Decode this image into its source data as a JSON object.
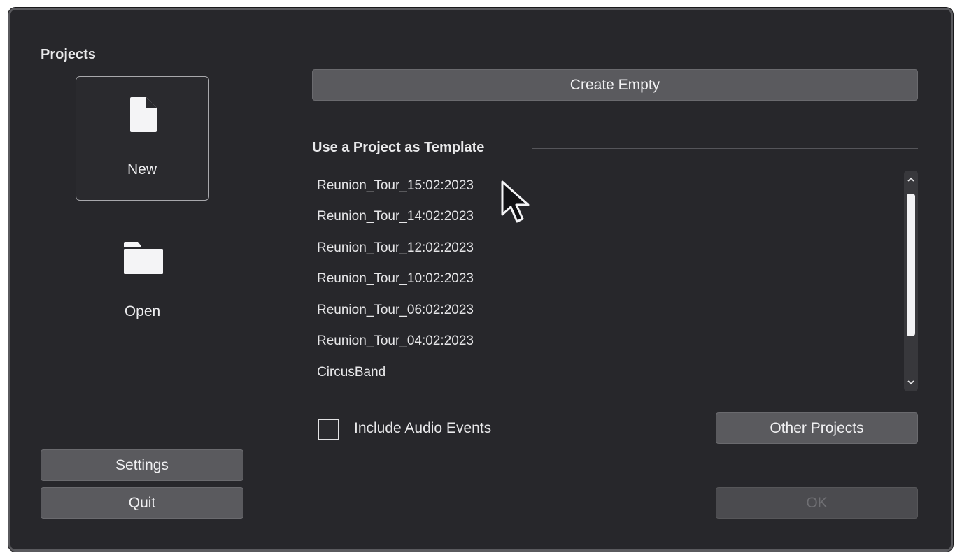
{
  "sidebar": {
    "title": "Projects",
    "new_label": "New",
    "open_label": "Open",
    "settings_label": "Settings",
    "quit_label": "Quit"
  },
  "main": {
    "create_empty_label": "Create Empty",
    "template_section_title": "Use a Project as Template",
    "templates": [
      "Reunion_Tour_15:02:2023",
      "Reunion_Tour_14:02:2023",
      "Reunion_Tour_12:02:2023",
      "Reunion_Tour_10:02:2023",
      "Reunion_Tour_06:02:2023",
      "Reunion_Tour_04:02:2023",
      "CircusBand"
    ],
    "include_audio_label": "Include Audio Events",
    "include_audio_checked": false,
    "other_projects_label": "Other Projects",
    "ok_label": "OK",
    "ok_enabled": false
  },
  "icons": {
    "new": "new-document-icon",
    "open": "folder-icon",
    "scroll_up": "chevron-up-icon",
    "scroll_down": "chevron-down-icon",
    "pointer": "mouse-pointer-icon"
  },
  "colors": {
    "background": "#27272b",
    "button": "#5a5a5e",
    "text": "#e8e8ea"
  }
}
